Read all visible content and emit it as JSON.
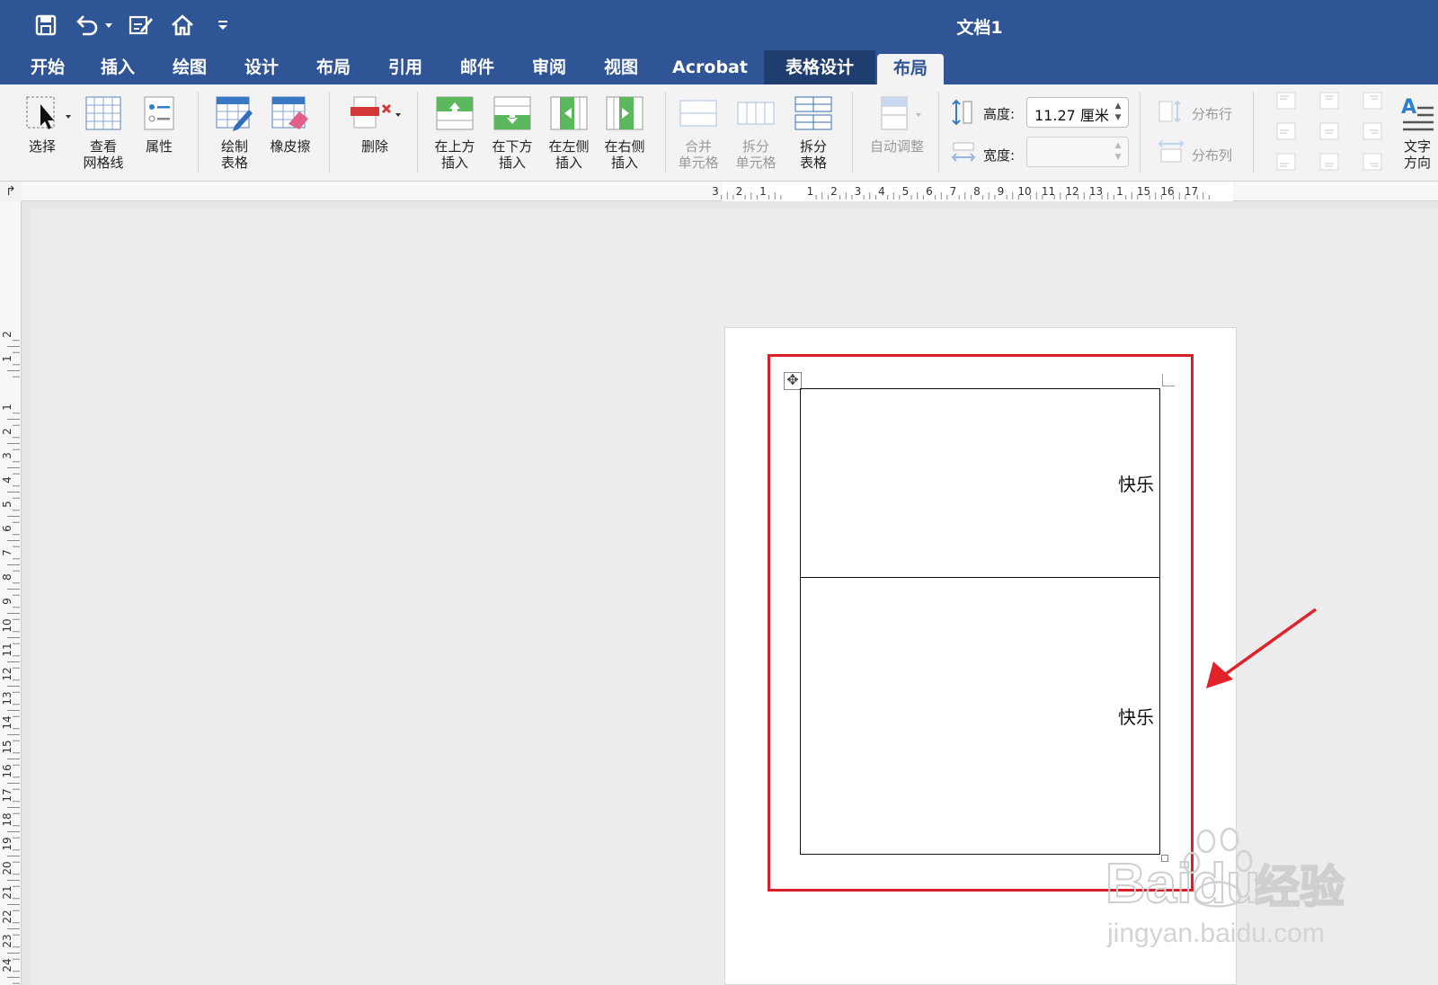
{
  "title_bar": {
    "quick_access": [
      "save-icon",
      "undo-icon",
      "edit-doc-icon",
      "home-icon",
      "customize-icon"
    ],
    "document_title": "文档1"
  },
  "tabs": [
    {
      "label": "开始",
      "state": "normal"
    },
    {
      "label": "插入",
      "state": "normal"
    },
    {
      "label": "绘图",
      "state": "normal"
    },
    {
      "label": "设计",
      "state": "normal"
    },
    {
      "label": "布局",
      "state": "normal"
    },
    {
      "label": "引用",
      "state": "normal"
    },
    {
      "label": "邮件",
      "state": "normal"
    },
    {
      "label": "审阅",
      "state": "normal"
    },
    {
      "label": "视图",
      "state": "normal"
    },
    {
      "label": "Acrobat",
      "state": "normal"
    },
    {
      "label": "表格设计",
      "state": "contextual"
    },
    {
      "label": "布局",
      "state": "active"
    }
  ],
  "ribbon": {
    "select": "选择",
    "view_gridlines": [
      "查看",
      "网格线"
    ],
    "properties": "属性",
    "draw_table": [
      "绘制",
      "表格"
    ],
    "eraser": "橡皮擦",
    "delete": "删除",
    "insert_above": [
      "在上方",
      "插入"
    ],
    "insert_below": [
      "在下方",
      "插入"
    ],
    "insert_left": [
      "在左侧",
      "插入"
    ],
    "insert_right": [
      "在右侧",
      "插入"
    ],
    "merge_cells": [
      "合并",
      "单元格"
    ],
    "split_cells": [
      "拆分",
      "单元格"
    ],
    "split_table": [
      "拆分",
      "表格"
    ],
    "autofit": "自动调整",
    "height_label": "高度:",
    "height_value": "11.27 厘米",
    "width_label": "宽度:",
    "width_value": "",
    "distribute_rows": "分布行",
    "distribute_columns": "分布列",
    "text_direction": [
      "文字",
      "方向"
    ]
  },
  "rulers": {
    "horizontal": [
      "3",
      "2",
      "1",
      "1",
      "2",
      "3",
      "4",
      "5",
      "6",
      "7",
      "8",
      "9",
      "10",
      "11",
      "12",
      "13",
      "1",
      "15",
      "16",
      "17"
    ],
    "vertical": [
      "2",
      "1",
      "1",
      "2",
      "3",
      "4",
      "5",
      "6",
      "7",
      "8",
      "9",
      "10",
      "11",
      "12",
      "13",
      "14",
      "15",
      "16",
      "17",
      "18",
      "19",
      "20",
      "21",
      "22",
      "23",
      "24"
    ]
  },
  "document": {
    "table_cells": [
      "快乐",
      "快乐"
    ]
  },
  "watermark": {
    "brand": "Baidu",
    "product": "经验",
    "url": "jingyan.baidu.com"
  },
  "colors": {
    "title_bar": "#2f5596",
    "highlight_box": "#d8202a",
    "annotation_arrow": "#e0232b"
  }
}
